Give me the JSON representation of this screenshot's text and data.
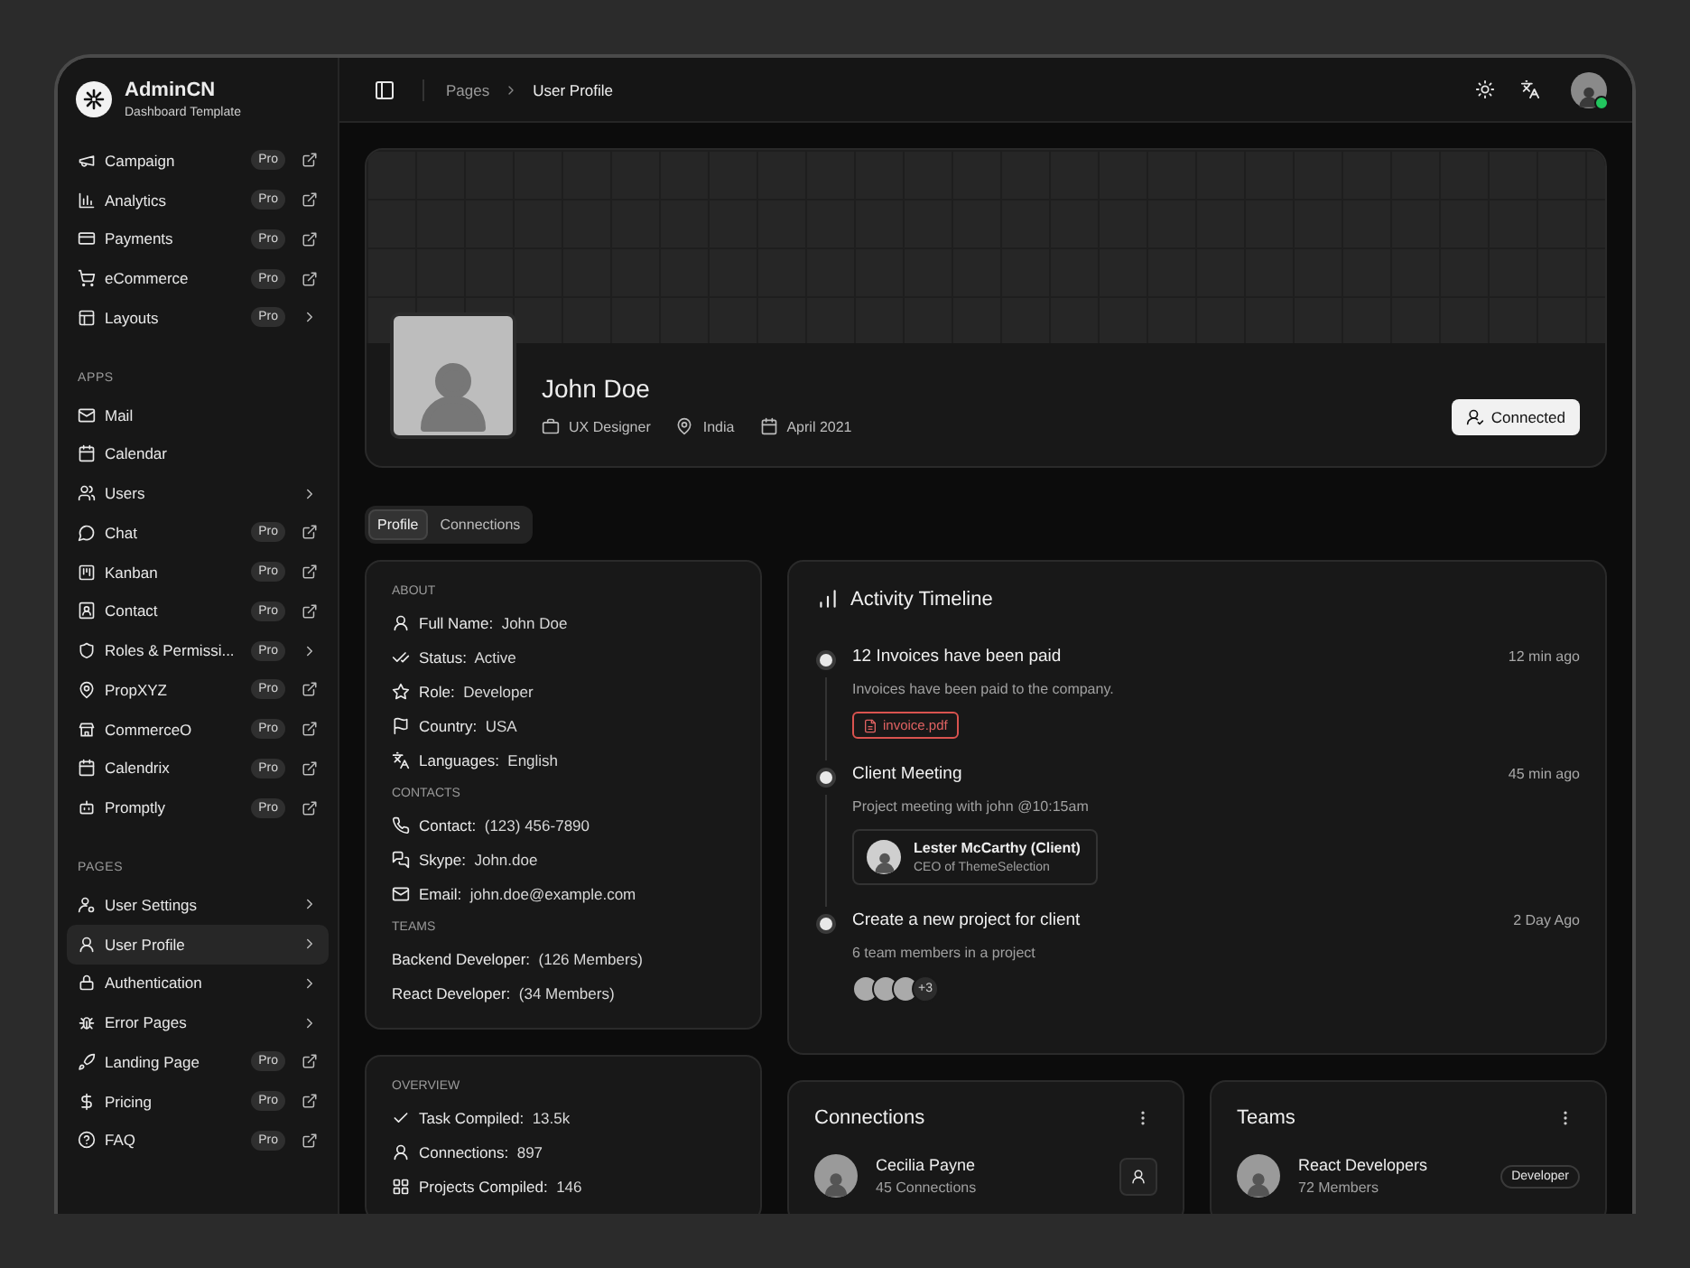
{
  "brand": {
    "name": "AdminCN",
    "subtitle": "Dashboard Template"
  },
  "sidebar": {
    "sections": [
      {
        "items": [
          {
            "label": "Campaign",
            "badge": "Pro",
            "kind": "external",
            "selected": false
          },
          {
            "label": "Analytics",
            "badge": "Pro",
            "kind": "external",
            "selected": false
          },
          {
            "label": "Payments",
            "badge": "Pro",
            "kind": "external",
            "selected": false
          },
          {
            "label": "eCommerce",
            "badge": "Pro",
            "kind": "external",
            "selected": false
          },
          {
            "label": "Layouts",
            "badge": "Pro",
            "kind": "submenu",
            "selected": false
          }
        ]
      },
      {
        "heading": "APPS",
        "items": [
          {
            "label": "Mail",
            "kind": "plain",
            "selected": false
          },
          {
            "label": "Calendar",
            "kind": "plain",
            "selected": false
          },
          {
            "label": "Users",
            "kind": "submenu",
            "selected": false
          },
          {
            "label": "Chat",
            "badge": "Pro",
            "kind": "external",
            "selected": false
          },
          {
            "label": "Kanban",
            "badge": "Pro",
            "kind": "external",
            "selected": false
          },
          {
            "label": "Contact",
            "badge": "Pro",
            "kind": "external",
            "selected": false
          },
          {
            "label": "Roles & Permissi...",
            "badge": "Pro",
            "kind": "submenu",
            "selected": false
          },
          {
            "label": "PropXYZ",
            "badge": "Pro",
            "kind": "external",
            "selected": false
          },
          {
            "label": "CommerceO",
            "badge": "Pro",
            "kind": "external",
            "selected": false
          },
          {
            "label": "Calendrix",
            "badge": "Pro",
            "kind": "external",
            "selected": false
          },
          {
            "label": "Promptly",
            "badge": "Pro",
            "kind": "external",
            "selected": false
          }
        ]
      },
      {
        "heading": "PAGES",
        "items": [
          {
            "label": "User Settings",
            "kind": "submenu",
            "selected": false
          },
          {
            "label": "User Profile",
            "kind": "submenu",
            "selected": true
          },
          {
            "label": "Authentication",
            "kind": "submenu",
            "selected": false
          },
          {
            "label": "Error Pages",
            "kind": "submenu",
            "selected": false
          },
          {
            "label": "Landing Page",
            "badge": "Pro",
            "kind": "external",
            "selected": false
          },
          {
            "label": "Pricing",
            "badge": "Pro",
            "kind": "external",
            "selected": false
          },
          {
            "label": "FAQ",
            "badge": "Pro",
            "kind": "external",
            "selected": false
          }
        ]
      }
    ]
  },
  "breadcrumb": [
    "Pages",
    "User Profile"
  ],
  "header": {
    "online": true
  },
  "profile": {
    "name": "John Doe",
    "meta": [
      "UX Designer",
      "India",
      "April 2021"
    ],
    "button": "Connected"
  },
  "tabs": [
    {
      "label": "Profile",
      "selected": true
    },
    {
      "label": "Connections",
      "selected": false
    }
  ],
  "about": {
    "sections": [
      {
        "heading": "ABOUT",
        "rows": [
          {
            "label": "Full Name:",
            "value": "John Doe"
          },
          {
            "label": "Status:",
            "value": "Active"
          },
          {
            "label": "Role:",
            "value": "Developer"
          },
          {
            "label": "Country:",
            "value": "USA"
          },
          {
            "label": "Languages:",
            "value": "English"
          }
        ]
      },
      {
        "heading": "CONTACTS",
        "rows": [
          {
            "label": "Contact:",
            "value": "(123) 456-7890"
          },
          {
            "label": "Skype:",
            "value": "John.doe"
          },
          {
            "label": "Email:",
            "value": "john.doe@example.com"
          }
        ]
      },
      {
        "heading": "TEAMS",
        "rows": [
          {
            "label": "Backend Developer:",
            "value": "(126 Members)"
          },
          {
            "label": "React Developer:",
            "value": "(34 Members)"
          }
        ]
      }
    ]
  },
  "overview": {
    "heading": "OVERVIEW",
    "rows": [
      {
        "label": "Task Compiled:",
        "value": "13.5k"
      },
      {
        "label": "Connections:",
        "value": "897"
      },
      {
        "label": "Projects Compiled:",
        "value": "146"
      }
    ]
  },
  "timeline": {
    "title": "Activity Timeline",
    "events": [
      {
        "title": "12 Invoices have been paid",
        "time": "12 min ago",
        "description": "Invoices have been paid to the company.",
        "attachment": "invoice.pdf"
      },
      {
        "title": "Client Meeting",
        "time": "45 min ago",
        "description": "Project meeting with john @10:15am",
        "contact": {
          "name": "Lester McCarthy (Client)",
          "role": "CEO of ThemeSelection"
        }
      },
      {
        "title": "Create a new project for client",
        "time": "2 Day Ago",
        "description": "6 team members in a project",
        "more": "+3"
      }
    ]
  },
  "connections": {
    "title": "Connections",
    "items": [
      {
        "name": "Cecilia Payne",
        "detail": "45 Connections"
      }
    ]
  },
  "teams": {
    "title": "Teams",
    "items": [
      {
        "name": "React Developers",
        "detail": "72 Members",
        "tag": "Developer"
      }
    ]
  }
}
